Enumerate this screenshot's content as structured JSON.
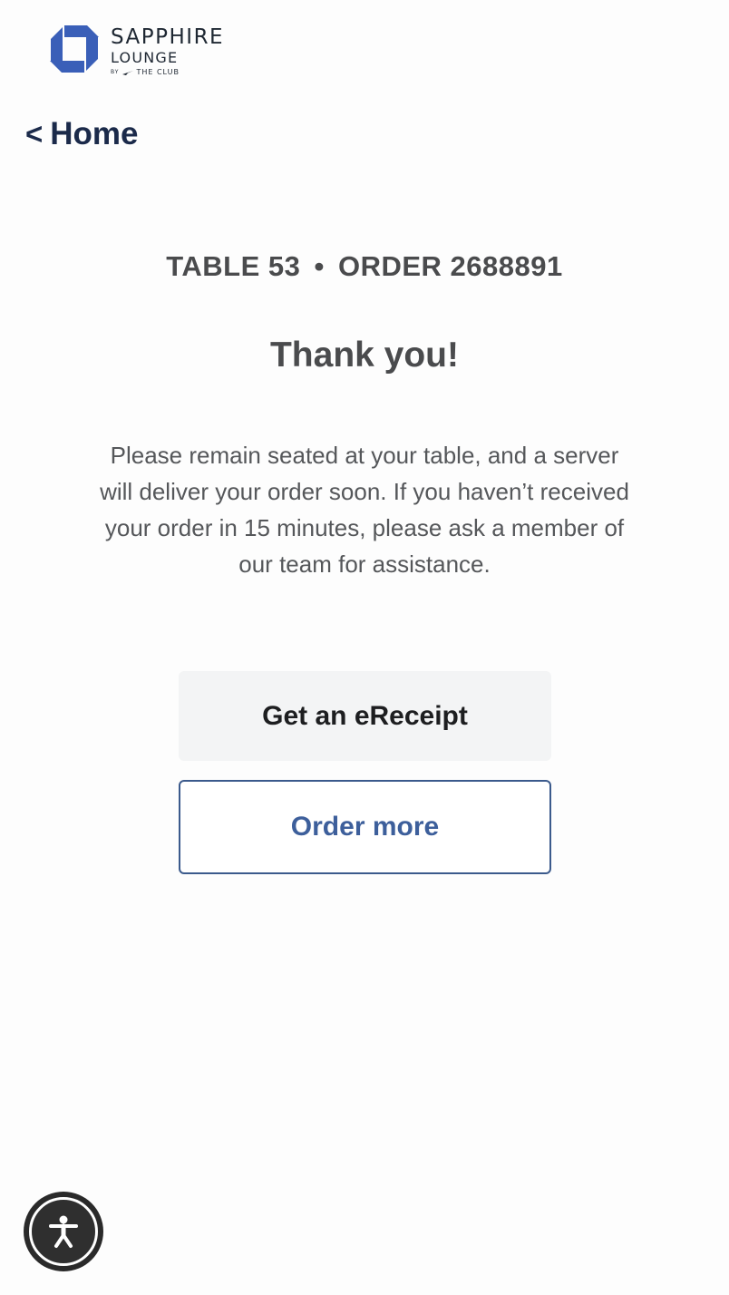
{
  "brand": {
    "line1": "SAPPHIRE",
    "line2": "LOUNGE",
    "by": "BY",
    "line3": "THE CLUB",
    "mark_color": "#3a5fb8"
  },
  "nav": {
    "back_chevron": "<",
    "back_label": "Home"
  },
  "order": {
    "table_label": "TABLE 53",
    "separator": "•",
    "order_label": "ORDER 2688891"
  },
  "confirmation": {
    "title": "Thank you!",
    "message": "Please remain seated at your table, and a server will deliver your order soon. If you haven’t received your order in 15 minutes, please ask a member of our team for assistance."
  },
  "actions": {
    "ereceipt_label": "Get an eReceipt",
    "order_more_label": "Order more"
  },
  "accessibility": {
    "icon": "accessibility-person-icon"
  },
  "colors": {
    "accent": "#3d5f9b",
    "nav_text": "#1b2a4a",
    "body_text": "#55575a"
  }
}
